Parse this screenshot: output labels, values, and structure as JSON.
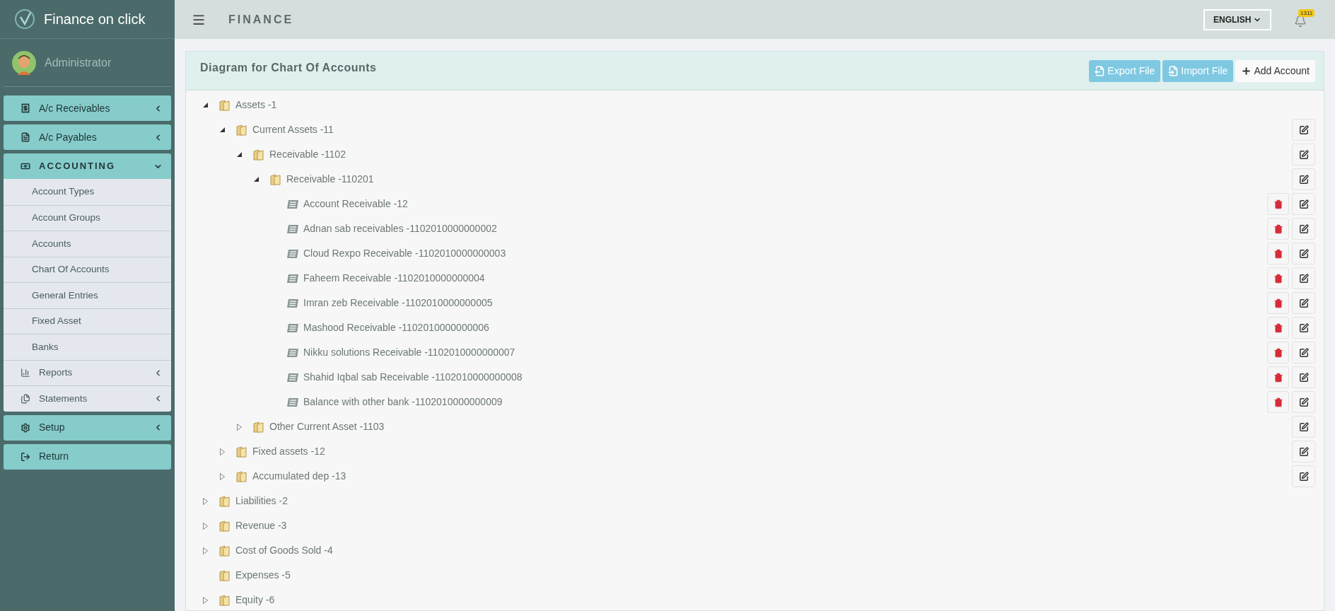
{
  "brand": "Finance on click",
  "user": {
    "name": "Administrator"
  },
  "sidebar": {
    "menu": [
      {
        "label": "A/c Receivables",
        "kind": "submenu",
        "expanded": false
      },
      {
        "label": "A/c Payables",
        "kind": "submenu",
        "expanded": false
      },
      {
        "label": "ACCOUNTING",
        "kind": "submenu",
        "expanded": true,
        "children": [
          {
            "label": "Account Types",
            "kind": "link"
          },
          {
            "label": "Account Groups",
            "kind": "link"
          },
          {
            "label": "Accounts",
            "kind": "link"
          },
          {
            "label": "Chart Of Accounts",
            "kind": "link"
          },
          {
            "label": "General Entries",
            "kind": "link"
          },
          {
            "label": "Fixed Asset",
            "kind": "link"
          },
          {
            "label": "Banks",
            "kind": "link"
          },
          {
            "label": "Reports",
            "kind": "submenu"
          },
          {
            "label": "Statements",
            "kind": "submenu"
          }
        ]
      },
      {
        "label": "Setup",
        "kind": "submenu",
        "expanded": false
      },
      {
        "label": "Return",
        "kind": "link"
      }
    ]
  },
  "header": {
    "title": "FINANCE",
    "language": "ENGLISH",
    "notifications": "1311"
  },
  "panel": {
    "title": "Diagram for Chart Of Accounts",
    "buttons": [
      {
        "label": "Export File",
        "kind": "export"
      },
      {
        "label": "Import File",
        "kind": "import"
      },
      {
        "label": "Add Account",
        "kind": "add"
      }
    ],
    "tree": [
      {
        "label": "Assets -1",
        "kind": "folder",
        "expanded": true,
        "editable": false,
        "children": [
          {
            "label": "Current Assets -11",
            "kind": "folder",
            "expanded": true,
            "editable": true,
            "children": [
              {
                "label": "Receivable -1102",
                "kind": "folder",
                "expanded": true,
                "editable": true,
                "children": [
                  {
                    "label": "Receivable -110201",
                    "kind": "folder",
                    "expanded": true,
                    "editable": true,
                    "children": [
                      {
                        "label": "Account Receivable -12",
                        "kind": "account",
                        "editable": true
                      },
                      {
                        "label": "Adnan sab receivables -1102010000000002",
                        "kind": "account",
                        "editable": true
                      },
                      {
                        "label": "Cloud Rexpo Receivable -1102010000000003",
                        "kind": "account",
                        "editable": true
                      },
                      {
                        "label": "Faheem Receivable -1102010000000004",
                        "kind": "account",
                        "editable": true
                      },
                      {
                        "label": "Imran zeb Receivable -1102010000000005",
                        "kind": "account",
                        "editable": true
                      },
                      {
                        "label": "Mashood Receivable -1102010000000006",
                        "kind": "account",
                        "editable": true
                      },
                      {
                        "label": "Nikku solutions Receivable -1102010000000007",
                        "kind": "account",
                        "editable": true
                      },
                      {
                        "label": "Shahid Iqbal sab Receivable -1102010000000008",
                        "kind": "account",
                        "editable": true
                      },
                      {
                        "label": "Balance with other bank -1102010000000009",
                        "kind": "account",
                        "editable": true
                      }
                    ]
                  }
                ]
              },
              {
                "label": "Other Current Asset -1103",
                "kind": "folder",
                "expanded": false,
                "editable": true
              }
            ]
          },
          {
            "label": "Fixed assets -12",
            "kind": "folder",
            "expanded": false,
            "editable": true
          },
          {
            "label": "Accumulated dep -13",
            "kind": "folder",
            "expanded": false,
            "editable": true
          }
        ]
      },
      {
        "label": "Liabilities -2",
        "kind": "folder",
        "expanded": false,
        "editable": false
      },
      {
        "label": "Revenue -3",
        "kind": "folder",
        "expanded": false,
        "editable": false
      },
      {
        "label": "Cost of Goods Sold -4",
        "kind": "folder",
        "expanded": false,
        "editable": false
      },
      {
        "label": "Expenses -5",
        "kind": "folder",
        "editable": false
      },
      {
        "label": "Equity -6",
        "kind": "folder",
        "expanded": false,
        "editable": false
      }
    ]
  }
}
